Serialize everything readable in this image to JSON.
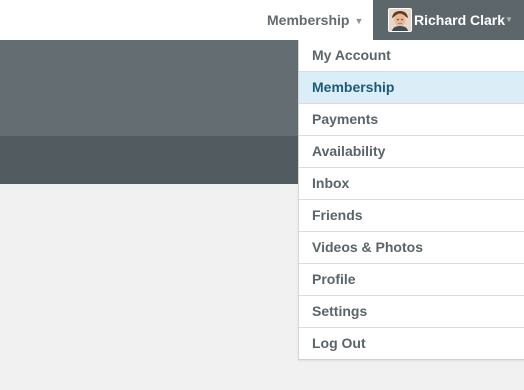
{
  "topbar": {
    "membership_label": "Membership",
    "membership_caret": "▼",
    "user_name": "Richard Clark",
    "user_caret": "▼"
  },
  "dropdown": {
    "items": [
      {
        "label": "My Account"
      },
      {
        "label": "Membership",
        "active": true
      },
      {
        "label": "Payments"
      },
      {
        "label": "Availability"
      },
      {
        "label": "Inbox"
      },
      {
        "label": "Friends"
      },
      {
        "label": "Videos & Photos"
      },
      {
        "label": "Profile"
      },
      {
        "label": "Settings"
      },
      {
        "label": "Log Out"
      }
    ]
  },
  "colors": {
    "topbar_bg": "#ffffff",
    "user_menu_bg": "#5d676b",
    "header_band_top": "#646e72",
    "header_band_bottom": "#525c60",
    "page_bg": "#f1f1f1",
    "active_item_bg": "#dbeef8",
    "active_item_text": "#1d5a78"
  }
}
